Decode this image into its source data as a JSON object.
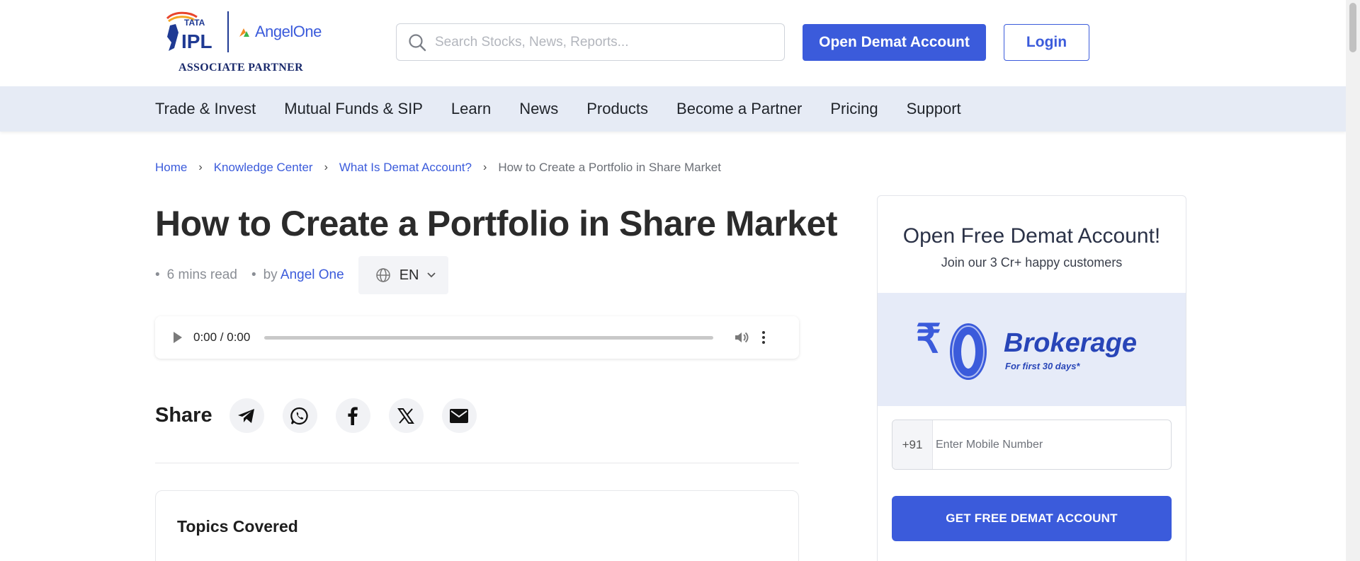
{
  "header": {
    "logo": {
      "ipl_text": "TATA IPL",
      "brand": "AngelOne",
      "tagline": "ASSOCIATE PARTNER"
    },
    "search": {
      "placeholder": "Search Stocks, News, Reports..."
    },
    "open_demat_label": "Open Demat Account",
    "login_label": "Login"
  },
  "nav": {
    "items": [
      "Trade & Invest",
      "Mutual Funds & SIP",
      "Learn",
      "News",
      "Products",
      "Become a Partner",
      "Pricing",
      "Support"
    ]
  },
  "breadcrumb": {
    "items": [
      "Home",
      "Knowledge Center",
      "What Is Demat Account?"
    ],
    "current": "How to Create a Portfolio in Share Market"
  },
  "article": {
    "title": "How to Create a Portfolio in Share Market",
    "read_time": "6 mins read",
    "by_prefix": "by",
    "author": "Angel One",
    "language": "EN",
    "audio_time": "0:00 / 0:00",
    "share_label": "Share",
    "share_icons": [
      "telegram-icon",
      "whatsapp-icon",
      "facebook-icon",
      "x-icon",
      "email-icon"
    ],
    "topics_title": "Topics Covered"
  },
  "sidebar_card": {
    "heading": "Open Free Demat Account!",
    "subheading": "Join our 3 Cr+ happy customers",
    "banner": {
      "symbol": "₹",
      "amount": "0",
      "label": "Brokerage",
      "note": "For first 30 days*"
    },
    "country_code": "+91",
    "mobile_placeholder": "Enter Mobile Number",
    "cta_label": "GET FREE DEMAT ACCOUNT"
  },
  "colors": {
    "primary": "#3b5bdb",
    "nav_bg": "#e6ebf5",
    "banner_bg": "#e6ebf8"
  }
}
